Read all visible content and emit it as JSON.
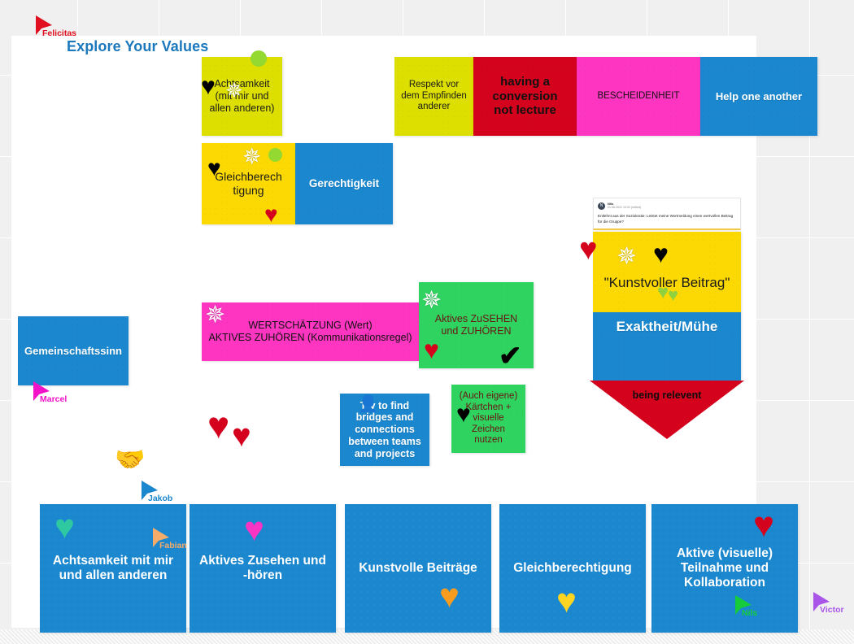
{
  "board": {
    "title": "Explore Your Values",
    "title_color": "#1b78bd",
    "background_color": "#f0f0f0",
    "canvas_color": "#ffffff"
  },
  "notes": [
    {
      "id": "achtsamkeit",
      "text": "Achtsamkeit\n(mit mir und allen anderen)",
      "color": "#dcdf00",
      "text_color": "#1b1b1b"
    },
    {
      "id": "respekt",
      "text": "Respekt vor dem Empfinden anderer",
      "color": "#dcdf00",
      "text_color": "#1b1b1b"
    },
    {
      "id": "conversion",
      "text": "having a conversion not lecture",
      "color": "#d4021d",
      "text_color": "#111111"
    },
    {
      "id": "bescheidenheit",
      "text": "BESCHEIDENHEIT",
      "color": "#fd35c0",
      "text_color": "#121212"
    },
    {
      "id": "help-one-another",
      "text": "Help one another",
      "color": "#1b87ce",
      "text_color": "#ffffff"
    },
    {
      "id": "gleichberechtigung",
      "text": "Gleichberechtigung",
      "color": "#fcd902",
      "text_color": "#1b1b1b"
    },
    {
      "id": "gerechtigkeit",
      "text": "Gerechtigkeit",
      "color": "#1b87ce",
      "text_color": "#ffffff"
    },
    {
      "id": "kunstvoller-beitrag",
      "text": "\"Kunstvoller Beitrag\"",
      "color": "#fcd902",
      "text_color": "#1b1b1b"
    },
    {
      "id": "exaktheit",
      "text": "Exaktheit/Mühe",
      "color": "#1b87ce",
      "text_color": "#ffffff"
    },
    {
      "id": "being-relevent",
      "text": "being relevent",
      "color": "#d4021d",
      "text_color": "#111111"
    },
    {
      "id": "wertschaetzung",
      "text": "WERTSCHÄTZUNG (Wert)\nAKTIVES ZUHÖREN (Kommunikationsregel)",
      "color": "#fd35c0",
      "text_color": "#121212"
    },
    {
      "id": "aktives-zusehen",
      "text": "Aktives ZuSEHEN und ZUHÖREN",
      "color": "#2fd35f",
      "text_color": "#6b1414"
    },
    {
      "id": "gemeinschaftssinn",
      "text": "Gemeinschaftssinn",
      "color": "#1b87ce",
      "text_color": "#ffffff"
    },
    {
      "id": "bridges",
      "text": "Try to find bridges and connections between teams and projects",
      "color": "#1b87ce",
      "text_color": "#ffffff"
    },
    {
      "id": "kaertchen",
      "text": "(Auch eigene) Kärtchen + visuelle Zeichen nutzen",
      "color": "#2fd35f",
      "text_color": "#6b1414"
    }
  ],
  "note_text": {
    "achtsamkeit_line1": "Achtsamkeit",
    "achtsamkeit_line2": "(mit mir und",
    "achtsamkeit_line3": "allen anderen)",
    "respekt": "Respekt vor dem Empfinden anderer",
    "conversion_line1": "having a",
    "conversion_line2": "conversion",
    "conversion_line3": "not lecture",
    "bescheidenheit": "BESCHEIDENHEIT",
    "help_one_another": "Help one another",
    "gleichberechtigung": "Gleichberech tigung",
    "gerechtigkeit": "Gerechtigkeit",
    "kunstvoller_beitrag": "\"Kunstvoller Beitrag\"",
    "exaktheit": "Exaktheit/Mühe",
    "being_relevent": "being relevent",
    "wertschaetzung_line1": "WERTSCHÄTZUNG (Wert)",
    "wertschaetzung_line2": "AKTIVES ZUHÖREN (Kommunikationsregel)",
    "aktives_zusehen_line1": "Aktives ZuSEHEN",
    "aktives_zusehen_line2": "und ZUHÖREN",
    "gemeinschaftssinn": "Gemeinschaftssinn",
    "bridges": "Try to find bridges and connections between teams and projects",
    "kaertchen_line1": "(Auch eigene)",
    "kaertchen_line2": "Kärtchen +",
    "kaertchen_line3": "visuelle",
    "kaertchen_line4": "Zeichen",
    "kaertchen_line5": "nutzen"
  },
  "bottom_cards": [
    {
      "id": "card-achtsamkeit",
      "line1": "Achtsamkeit mit mir",
      "line2": "und allen anderen",
      "color": "#1b87ce",
      "heart": "teal"
    },
    {
      "id": "card-zusehen",
      "line1": "Aktives Zusehen und",
      "line2": "-hören",
      "color": "#1b87ce",
      "heart": "magenta"
    },
    {
      "id": "card-kunstvolle",
      "line1": "Kunstvolle Beiträge",
      "line2": "",
      "color": "#1b87ce",
      "heart": "orange"
    },
    {
      "id": "card-gleichberecht",
      "line1": "Gleichberechtigung",
      "line2": "",
      "color": "#1b87ce",
      "heart": "yellow"
    },
    {
      "id": "card-aktive",
      "line1": "Aktive (visuelle)",
      "line2": "Teilnahme und Kollaboration",
      "color": "#1b87ce",
      "heart": "red"
    }
  ],
  "bottom_card_text": {
    "achtsamkeit_l1": "Achtsamkeit mit mir",
    "achtsamkeit_l2": "und allen anderen",
    "zusehen_l1": "Aktives Zusehen und",
    "zusehen_l2": "-hören",
    "kunstvolle": "Kunstvolle Beiträge",
    "gleichberechtigung": "Gleichberechtigung",
    "aktive_l1": "Aktive (visuelle)",
    "aktive_l2": "Teilnahme und",
    "aktive_l3": "Kollaboration"
  },
  "cursors": [
    {
      "name": "Felicitas",
      "color": "#e01020"
    },
    {
      "name": "Marcel",
      "color": "#f312c8"
    },
    {
      "name": "Fabian",
      "color": "#f5ac6a"
    },
    {
      "name": "Nils",
      "color": "#16cc3a"
    },
    {
      "name": "Victor",
      "color": "#a855e8"
    },
    {
      "name": "Jakob",
      "color": "#1b87ce"
    }
  ],
  "comment": {
    "author": "Nils",
    "date": "01.08.2021 13:31 (edited)",
    "body": "Entlehnt aus der Soziokratie: Leistet meine Wortmeldung einen wertvollen Beitrag für die Gruppe?"
  },
  "stickers": {
    "handshake": "🤝",
    "heart_black": "♥",
    "heart_red": "♥",
    "check": "✔"
  }
}
